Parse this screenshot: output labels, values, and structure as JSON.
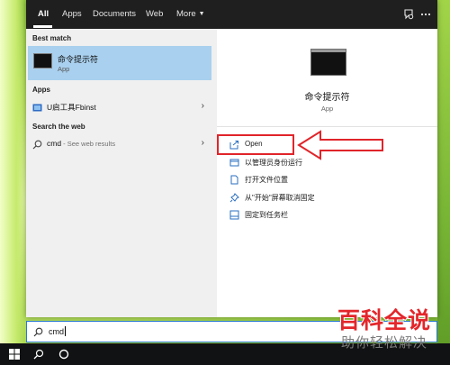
{
  "header": {
    "tabs": [
      {
        "label": "All",
        "active": true
      },
      {
        "label": "Apps"
      },
      {
        "label": "Documents"
      },
      {
        "label": "Web"
      },
      {
        "label": "More"
      }
    ],
    "icons": [
      "feedback-icon",
      "more-options-icon"
    ]
  },
  "left": {
    "best_match": {
      "heading": "Best match",
      "title": "命令提示符",
      "subtitle": "App"
    },
    "apps": {
      "heading": "Apps",
      "items": [
        {
          "label": "U启工具Fbinst"
        }
      ]
    },
    "web": {
      "heading": "Search the web",
      "items": [
        {
          "label": "cmd",
          "hint": " - See web results"
        }
      ]
    }
  },
  "detail": {
    "title": "命令提示符",
    "subtitle": "App",
    "actions": [
      {
        "label": "Open",
        "icon": "open-icon"
      },
      {
        "label": "以管理员身份运行",
        "icon": "shield-icon"
      },
      {
        "label": "打开文件位置",
        "icon": "file-location-icon"
      },
      {
        "label": "从\"开始\"屏幕取消固定",
        "icon": "unpin-icon"
      },
      {
        "label": "固定到任务栏",
        "icon": "pin-icon"
      }
    ]
  },
  "search": {
    "value": "cmd"
  },
  "taskbar": {
    "icons": [
      "windows-icon",
      "search-icon",
      "cortana-icon"
    ]
  },
  "annotation": {
    "color": "#e0242a"
  },
  "watermark": {
    "main": "百科全说",
    "sub": "助你轻松解决"
  },
  "colors": {
    "accent": "#2878d0",
    "selection": "#a9d0ee",
    "topbar": "#1f1f1f"
  }
}
